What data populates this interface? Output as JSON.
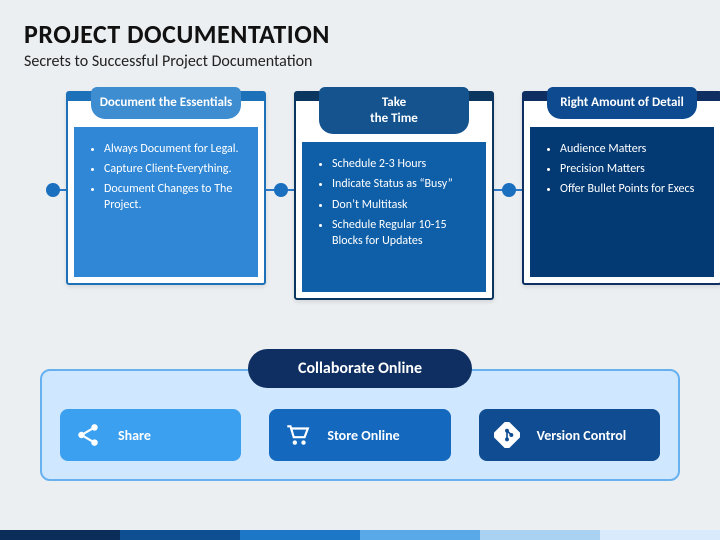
{
  "title": "PROJECT DOCUMENTATION",
  "subtitle": "Secrets to Successful Project Documentation",
  "cards": [
    {
      "tab": "Document the Essentials",
      "points": [
        "Always Document for Legal.",
        "Capture Client-Everything.",
        "Document Changes to The Project."
      ],
      "colors": {
        "border": "#1d71b8",
        "tab": "#3d8dd0",
        "body": "#2f87d6"
      }
    },
    {
      "tab": "Take\nthe Time",
      "points": [
        "Schedule 2-3 Hours",
        "Indicate Status as “Busy”",
        "Don’t Multitask",
        "Schedule Regular 10-15 Blocks for Updates"
      ],
      "colors": {
        "border": "#0b365f",
        "tab": "#15538f",
        "body": "#0f5fa8"
      }
    },
    {
      "tab": "Right Amount of Detail",
      "points": [
        "Audience Matters",
        "Precision Matters",
        "Offer Bullet Points for Execs"
      ],
      "colors": {
        "border": "#0f2f62",
        "tab": "#0d4a8f",
        "body": "#033a73"
      }
    }
  ],
  "collaborate": {
    "header": "Collaborate Online",
    "items": [
      {
        "label": "Share",
        "icon": "share",
        "bg": "#3ca0f0"
      },
      {
        "label": "Store Online",
        "icon": "cart",
        "bg": "#1469bf"
      },
      {
        "label": "Version Control",
        "icon": "git",
        "bg": "#0f4c91"
      }
    ]
  },
  "footerColors": [
    "#0a2d59",
    "#0e4f91",
    "#1c77c6",
    "#59a8e8",
    "#a9d1f2",
    "#d8eafb"
  ]
}
